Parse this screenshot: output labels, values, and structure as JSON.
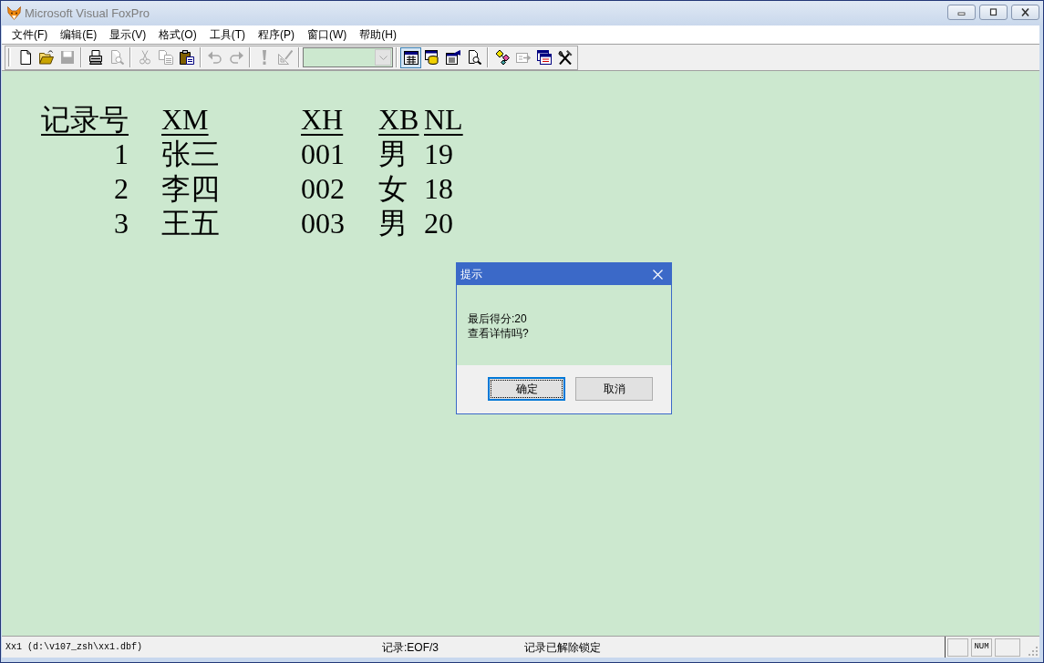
{
  "window": {
    "title": "Microsoft Visual FoxPro"
  },
  "menu": [
    {
      "label": "文件(F)"
    },
    {
      "label": "编辑(E)"
    },
    {
      "label": "显示(V)"
    },
    {
      "label": "格式(O)"
    },
    {
      "label": "工具(T)"
    },
    {
      "label": "程序(P)"
    },
    {
      "label": "窗口(W)"
    },
    {
      "label": "帮助(H)"
    }
  ],
  "toolbar": [
    [
      {
        "kind": "button",
        "disabled": false,
        "pressed": false
      },
      {
        "kind": "button",
        "disabled": false,
        "pressed": false
      },
      {
        "kind": "button",
        "disabled": true,
        "pressed": false
      }
    ],
    [
      {
        "kind": "button",
        "disabled": false,
        "pressed": false
      },
      {
        "kind": "button",
        "disabled": true,
        "pressed": false
      }
    ],
    [
      {
        "kind": "button",
        "disabled": true,
        "pressed": false
      },
      {
        "kind": "button",
        "disabled": true,
        "pressed": false
      },
      {
        "kind": "button",
        "disabled": false,
        "pressed": false
      }
    ],
    [
      {
        "kind": "button",
        "disabled": true,
        "pressed": false
      },
      {
        "kind": "button",
        "disabled": true,
        "pressed": false
      }
    ],
    [
      {
        "kind": "button",
        "disabled": true,
        "pressed": false
      },
      {
        "kind": "button",
        "disabled": true,
        "pressed": false
      }
    ],
    [
      {
        "kind": "combo",
        "disabled": true
      }
    ],
    [
      {
        "kind": "button",
        "disabled": false,
        "pressed": true
      },
      {
        "kind": "button",
        "disabled": false,
        "pressed": false
      },
      {
        "kind": "button",
        "disabled": false,
        "pressed": false
      },
      {
        "kind": "button",
        "disabled": false,
        "pressed": false
      }
    ],
    [
      {
        "kind": "button",
        "disabled": false,
        "pressed": false
      },
      {
        "kind": "button",
        "disabled": true,
        "pressed": false
      },
      {
        "kind": "button",
        "disabled": false,
        "pressed": false
      },
      {
        "kind": "button",
        "disabled": false,
        "pressed": false
      }
    ]
  ],
  "report": {
    "columns": [
      "记录号",
      "XM",
      "XH",
      "XB",
      "NL"
    ],
    "rows": [
      [
        "1",
        "张三",
        "001",
        "男",
        "19"
      ],
      [
        "2",
        "李四",
        "002",
        "女",
        "18"
      ],
      [
        "3",
        "王五",
        "003",
        "男",
        "20"
      ]
    ]
  },
  "dialog": {
    "title": "提示",
    "lines": [
      "最后得分:20",
      "查看详情吗?"
    ],
    "buttons": [
      {
        "label": "确定",
        "selected": true
      },
      {
        "label": "取消",
        "selected": false
      }
    ]
  },
  "status_bar": {
    "file": "Xx1 (d:\\v107_zsh\\xx1.dbf)",
    "record": "记录:EOF/3",
    "lock": "记录已解除锁定",
    "indicators": [
      {
        "kind": "blank"
      },
      {
        "kind": "label",
        "label": "NUM"
      },
      {
        "kind": "blank"
      }
    ]
  }
}
